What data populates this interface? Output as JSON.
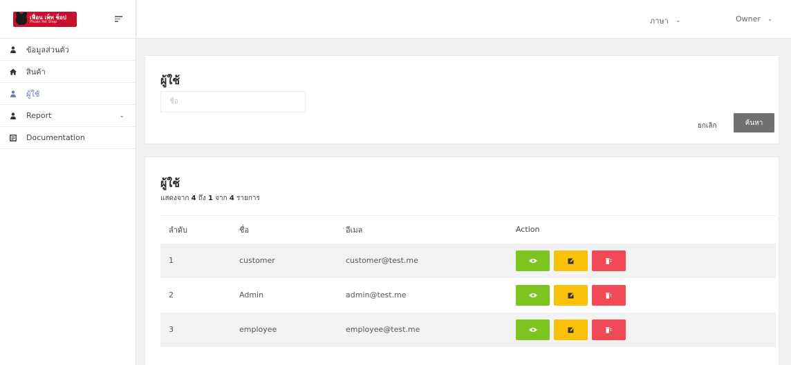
{
  "logo": {
    "main": "เฟื่อน เพ็ท ช็อป",
    "sub": "Phuen Pet Shop"
  },
  "sidebar": {
    "items": [
      {
        "label": "ข้อมูลส่วนตัว",
        "icon": "user-icon"
      },
      {
        "label": "สินค้า",
        "icon": "home-icon"
      },
      {
        "label": "ผู้ใช้",
        "icon": "user-icon",
        "active": true
      },
      {
        "label": "Report",
        "icon": "user-icon",
        "has_children": true
      },
      {
        "label": "Documentation",
        "icon": "document-icon"
      }
    ]
  },
  "header": {
    "language": "ภาษา",
    "user": "Owner"
  },
  "search_card": {
    "title": "ผู้ใช้",
    "name_placeholder": "ชื่อ",
    "cancel_label": "ยกเลิก",
    "search_label": "ค้นหา"
  },
  "table_card": {
    "title": "ผู้ใช้",
    "count": {
      "prefix": "แสดงจาก",
      "from": "4",
      "to_word": "ถึง",
      "to": "1",
      "of_word": "จาก",
      "total": "4",
      "suffix": "รายการ"
    },
    "columns": [
      "ลำดับ",
      "ชื่อ",
      "อีเมล",
      "Action"
    ],
    "rows": [
      {
        "no": "1",
        "name": "customer",
        "email": "customer@test.me"
      },
      {
        "no": "2",
        "name": "Admin",
        "email": "admin@test.me"
      },
      {
        "no": "3",
        "name": "employee",
        "email": "employee@test.me"
      }
    ]
  },
  "colors": {
    "view": "#7cc41f",
    "edit": "#f9c00c",
    "delete": "#f04a56",
    "search_button": "#707070",
    "logo": "#c8102e",
    "active_nav": "#6b7bb8"
  }
}
